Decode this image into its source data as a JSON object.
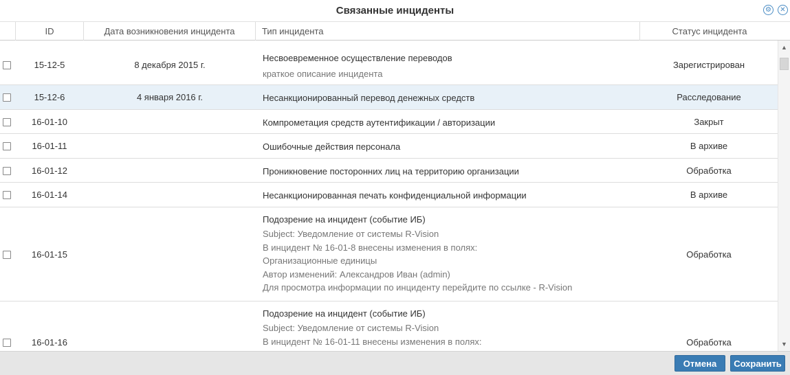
{
  "dialog": {
    "title": "Связанные инциденты",
    "icons": [
      "settings-icon",
      "close-icon"
    ]
  },
  "columns": {
    "id": "ID",
    "date": "Дата возникновения инцидента",
    "type": "Тип инцидента",
    "status": "Статус инцидента"
  },
  "rows": [
    {
      "id": "15-12-5",
      "date": "8 декабря 2015 г.",
      "type_title": "Несвоевременное осуществление переводов",
      "type_desc": [
        "краткое описание инцидента"
      ],
      "status": "Зарегистрирован",
      "selected": false
    },
    {
      "id": "15-12-6",
      "date": "4 января 2016 г.",
      "type_title": "Несанкционированный перевод денежных средств",
      "type_desc": [],
      "status": "Расследование",
      "selected": true
    },
    {
      "id": "16-01-10",
      "date": "",
      "type_title": "Компрометация средств аутентификации / авторизации",
      "type_desc": [],
      "status": "Закрыт",
      "selected": false
    },
    {
      "id": "16-01-11",
      "date": "",
      "type_title": "Ошибочные действия персонала",
      "type_desc": [],
      "status": "В архиве",
      "selected": false
    },
    {
      "id": "16-01-12",
      "date": "",
      "type_title": "Проникновение посторонних лиц на территорию организации",
      "type_desc": [],
      "status": "Обработка",
      "selected": false
    },
    {
      "id": "16-01-14",
      "date": "",
      "type_title": "Несанкционированная печать конфиденциальной информации",
      "type_desc": [],
      "status": "В архиве",
      "selected": false
    },
    {
      "id": "16-01-15",
      "date": "",
      "type_title": "Подозрение на инцидент (событие ИБ)",
      "type_desc": [
        "Subject: Уведомление от системы R-Vision",
        "В инцидент № 16-01-8 внесены изменения в полях:",
        "Организационные единицы",
        "Автор изменений: Александров Иван (admin)",
        "Для просмотра информации по инциденту перейдите по ссылке - R-Vision"
      ],
      "status": "Обработка",
      "selected": false
    },
    {
      "id": "16-01-16",
      "date": "",
      "type_title": "Подозрение на инцидент (событие ИБ)",
      "type_desc": [
        "Subject: Уведомление от системы R-Vision",
        "В инцидент № 16-01-11 внесены изменения в полях:"
      ],
      "status": "Обработка",
      "selected": false
    }
  ],
  "footer": {
    "cancel_label": "Отмена",
    "save_label": "Сохранить"
  }
}
